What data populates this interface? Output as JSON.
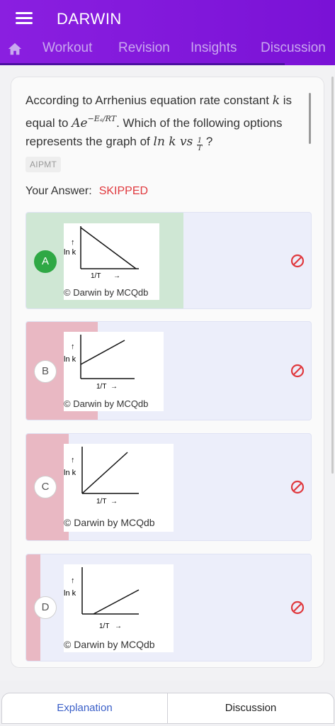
{
  "app": {
    "title": "DARWIN"
  },
  "tabs": [
    {
      "label": "Workout"
    },
    {
      "label": "Revision"
    },
    {
      "label": "Insights"
    },
    {
      "label": "Discussion"
    }
  ],
  "question": {
    "text_1": "According to Arrhenius equation rate constant",
    "k": "k",
    "text_2": " is equal to ",
    "A": "Ae",
    "exponent": "−Eₐ/RT",
    "text_3": ". Which of the following options represents the graph of ",
    "lnk": "ln k vs ",
    "frac_num": "1",
    "frac_den": "T",
    "text_4": " ?",
    "source": "AIPMT"
  },
  "answer": {
    "label": "Your Answer:",
    "value": "SKIPPED"
  },
  "graph_labels": {
    "y": "ln k",
    "x": "1/T",
    "watermark": "© Darwin by MCQdb"
  },
  "options": [
    {
      "letter": "A",
      "correct": true
    },
    {
      "letter": "B",
      "correct": false
    },
    {
      "letter": "C",
      "correct": false
    },
    {
      "letter": "D",
      "correct": false
    }
  ],
  "bottom": {
    "explanation": "Explanation",
    "discussion": "Discussion"
  },
  "colors": {
    "brand": "#8a1fe0",
    "correct_fill": "#cfe7d4",
    "wrong_fill": "#e9b8c3",
    "skipped": "#e0393e",
    "option_bg": "#eceefa"
  }
}
